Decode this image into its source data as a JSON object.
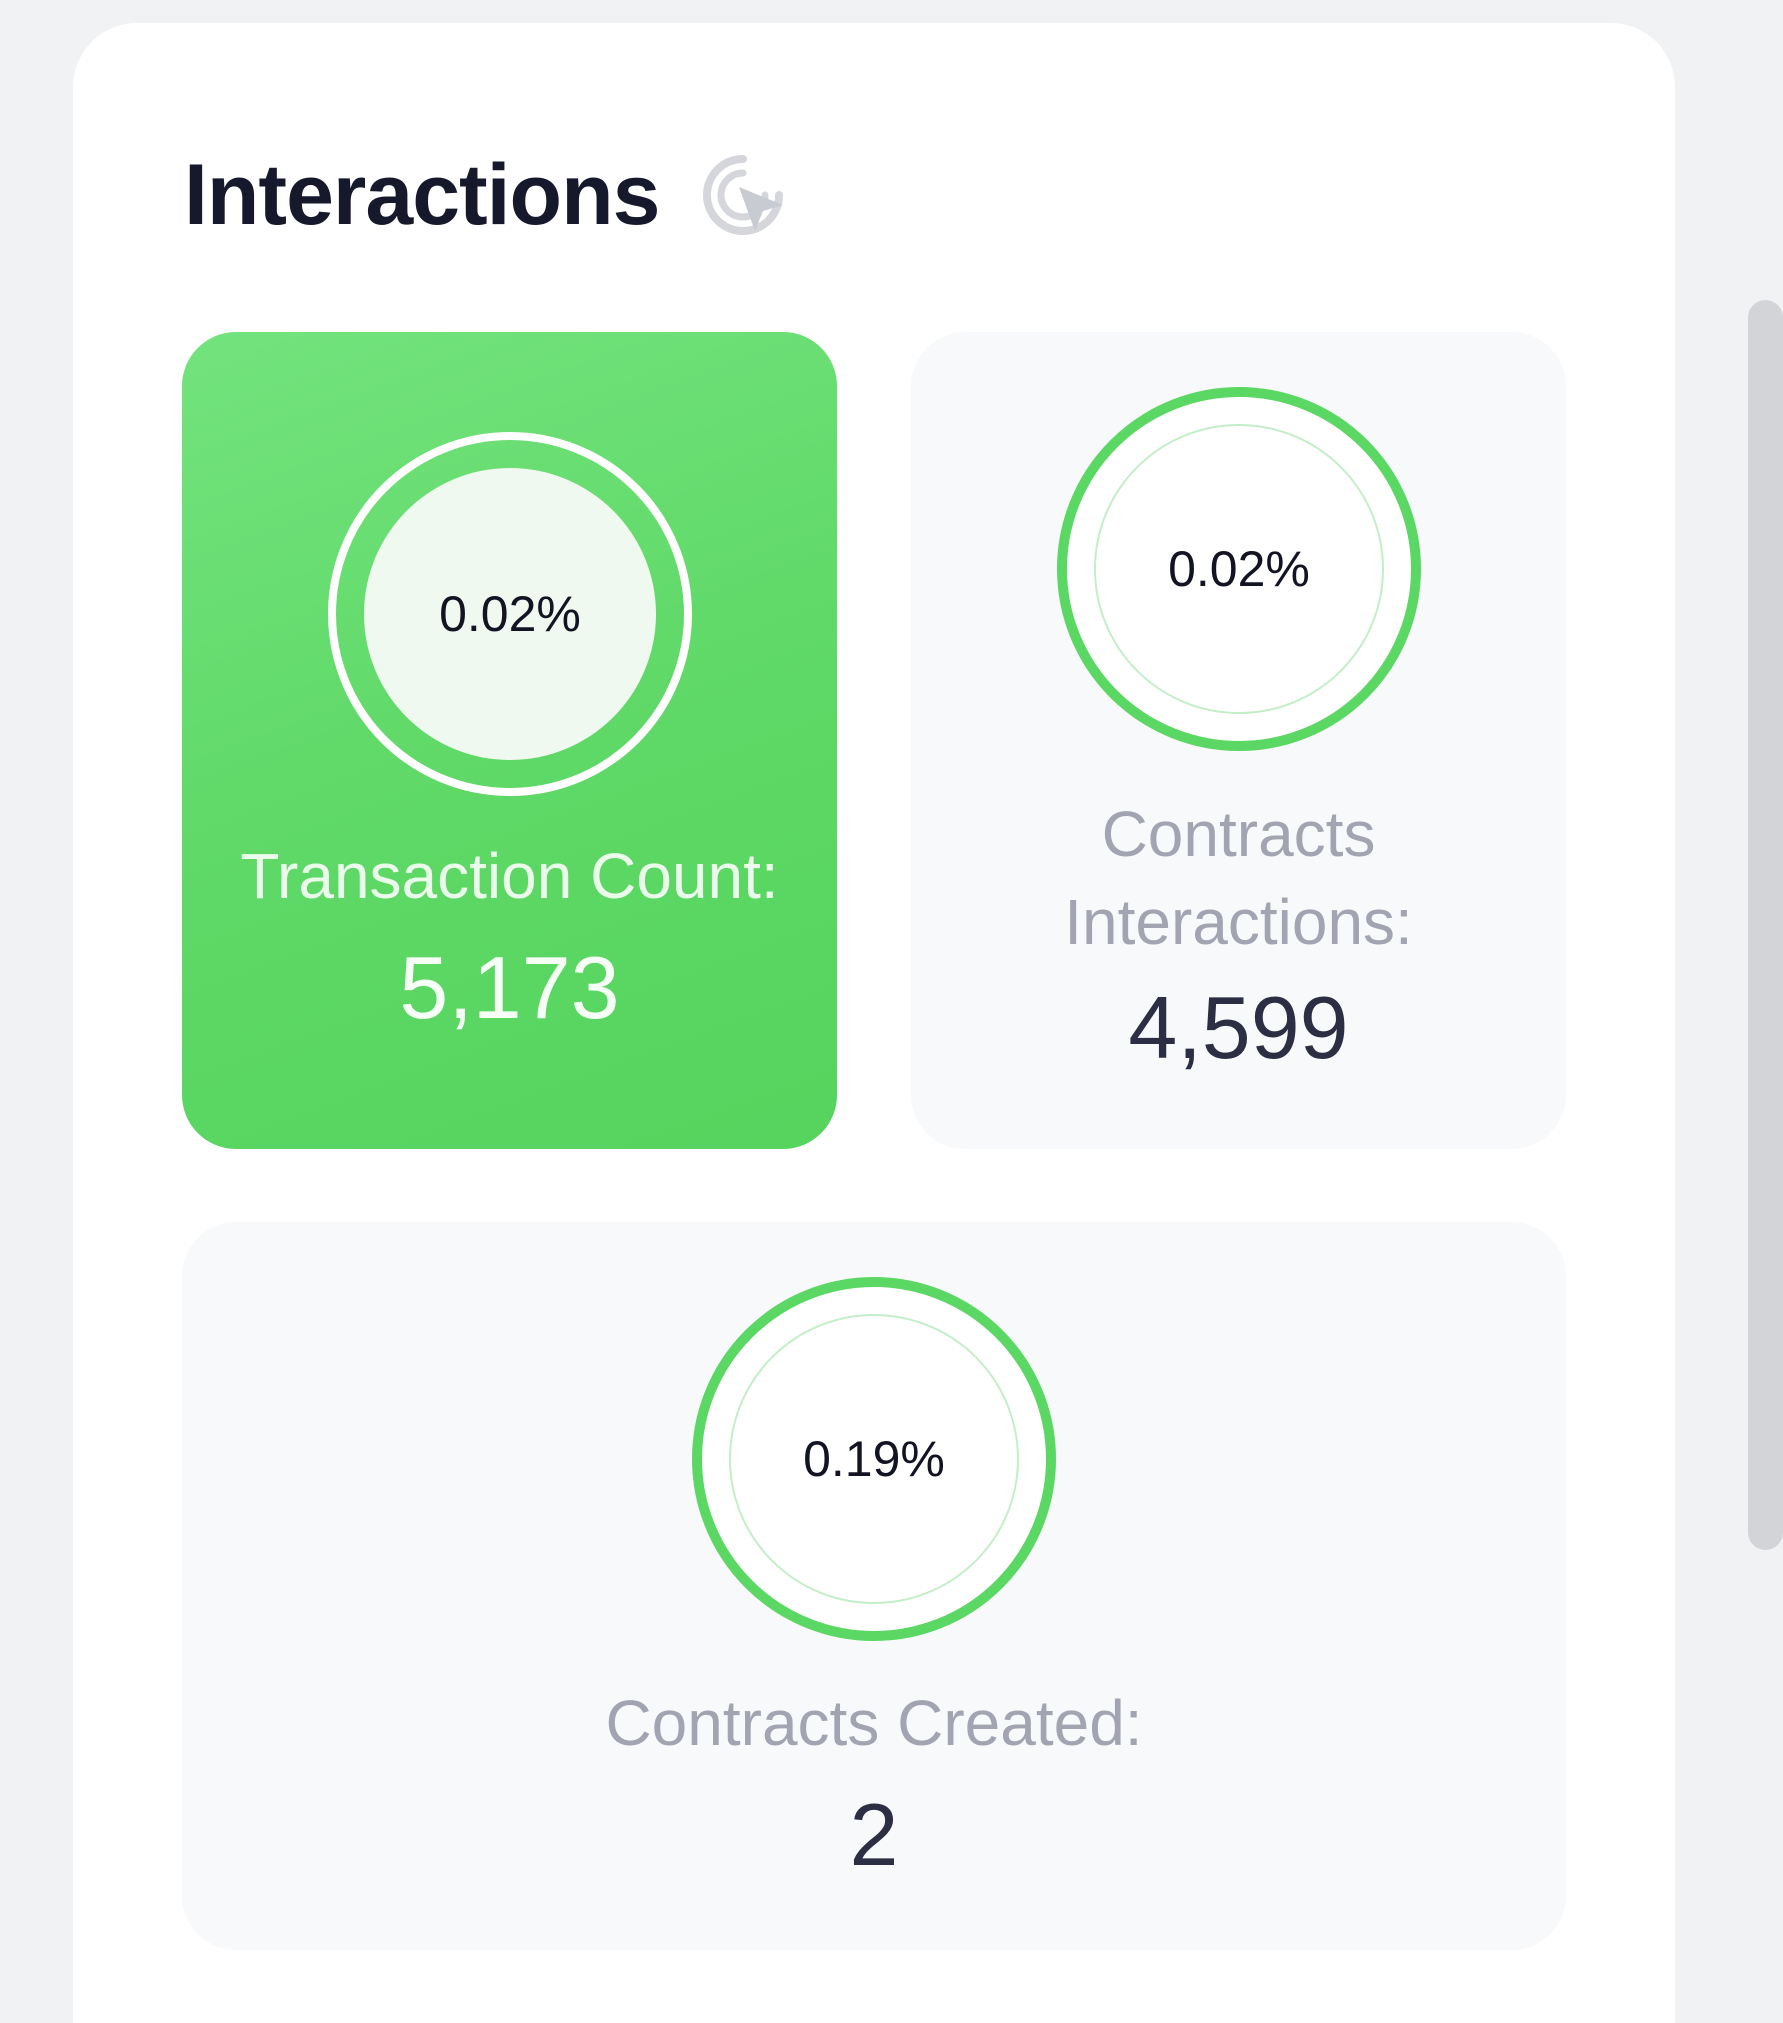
{
  "header": {
    "title": "Interactions",
    "icon": "cursor-click-icon"
  },
  "cards": {
    "transaction_count": {
      "percent": "0.02%",
      "label": "Transaction Count:",
      "value": "5,173"
    },
    "contracts_interactions": {
      "percent": "0.02%",
      "label": "Contracts Interactions:",
      "value": "4,599"
    },
    "contracts_created": {
      "percent": "0.19%",
      "label": "Contracts Created:",
      "value": "2"
    }
  },
  "colors": {
    "accent_green": "#5bd764",
    "title_text": "#16192b",
    "muted_label": "#a2a5b1"
  }
}
